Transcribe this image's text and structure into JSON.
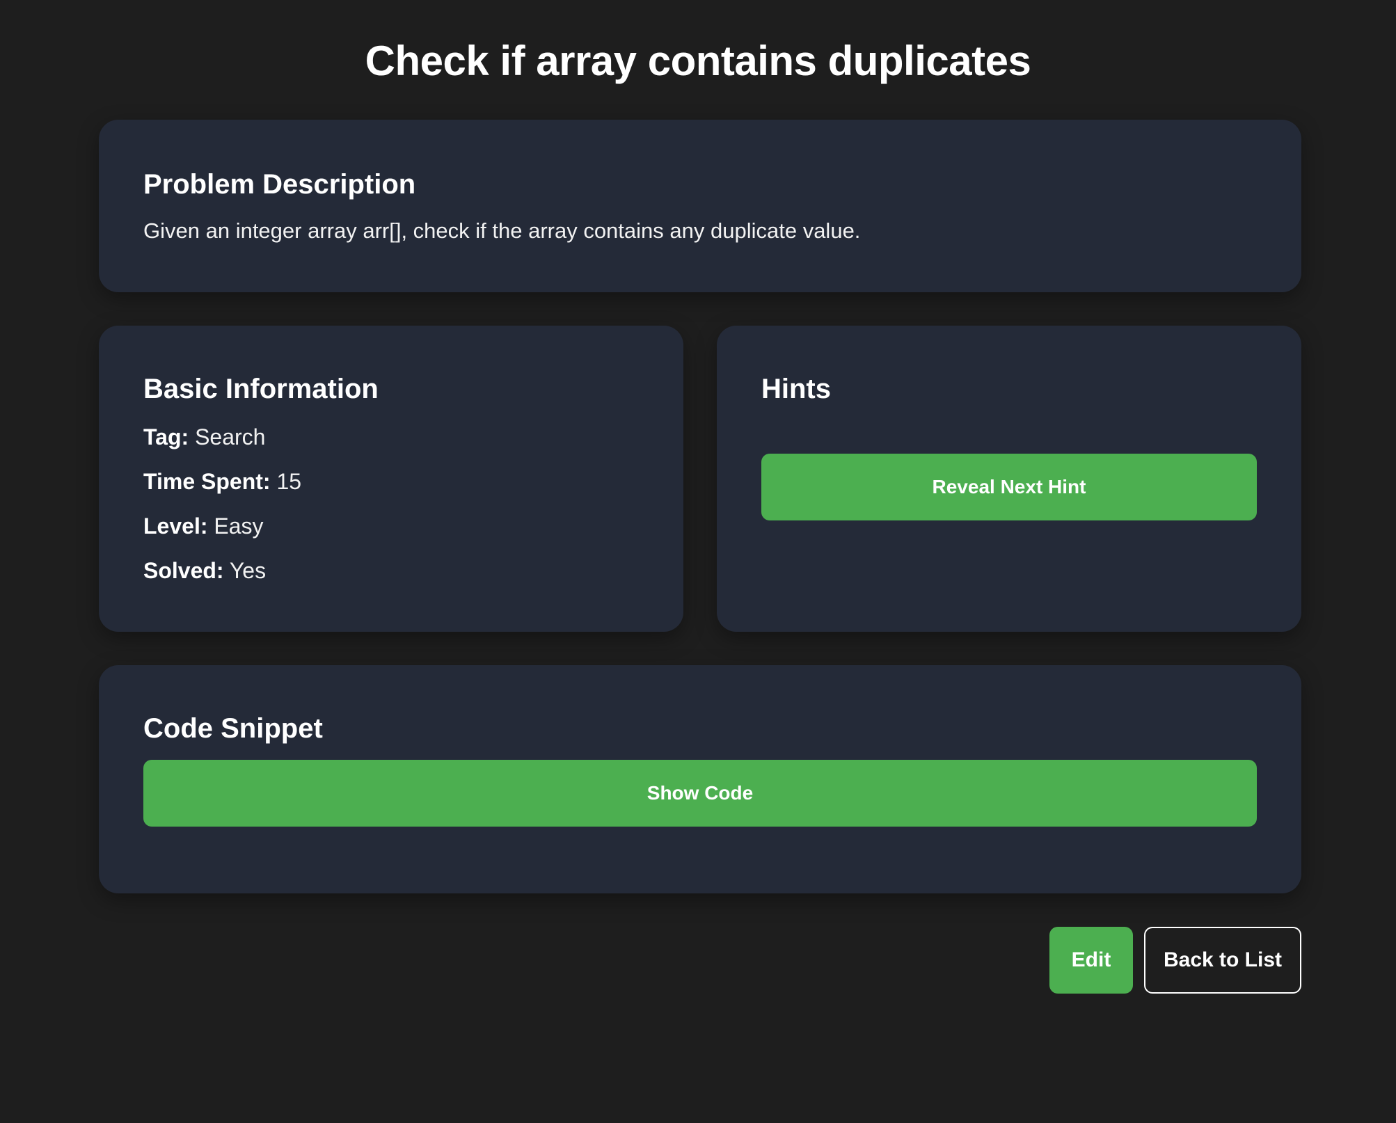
{
  "page": {
    "title": "Check if array contains duplicates"
  },
  "description": {
    "heading": "Problem Description",
    "text": "Given an integer array arr[], check if the array contains any duplicate value."
  },
  "basic_info": {
    "heading": "Basic Information",
    "items": [
      {
        "label": "Tag:",
        "value": "Search"
      },
      {
        "label": "Time Spent:",
        "value": "15"
      },
      {
        "label": "Level:",
        "value": "Easy"
      },
      {
        "label": "Solved:",
        "value": "Yes"
      }
    ]
  },
  "hints": {
    "heading": "Hints",
    "reveal_label": "Reveal Next Hint"
  },
  "code": {
    "heading": "Code Snippet",
    "show_label": "Show Code"
  },
  "actions": {
    "edit_label": "Edit",
    "back_label": "Back to List"
  },
  "colors": {
    "background": "#1e1e1e",
    "card": "#242a38",
    "accent": "#4caf50",
    "text": "#ffffff"
  }
}
